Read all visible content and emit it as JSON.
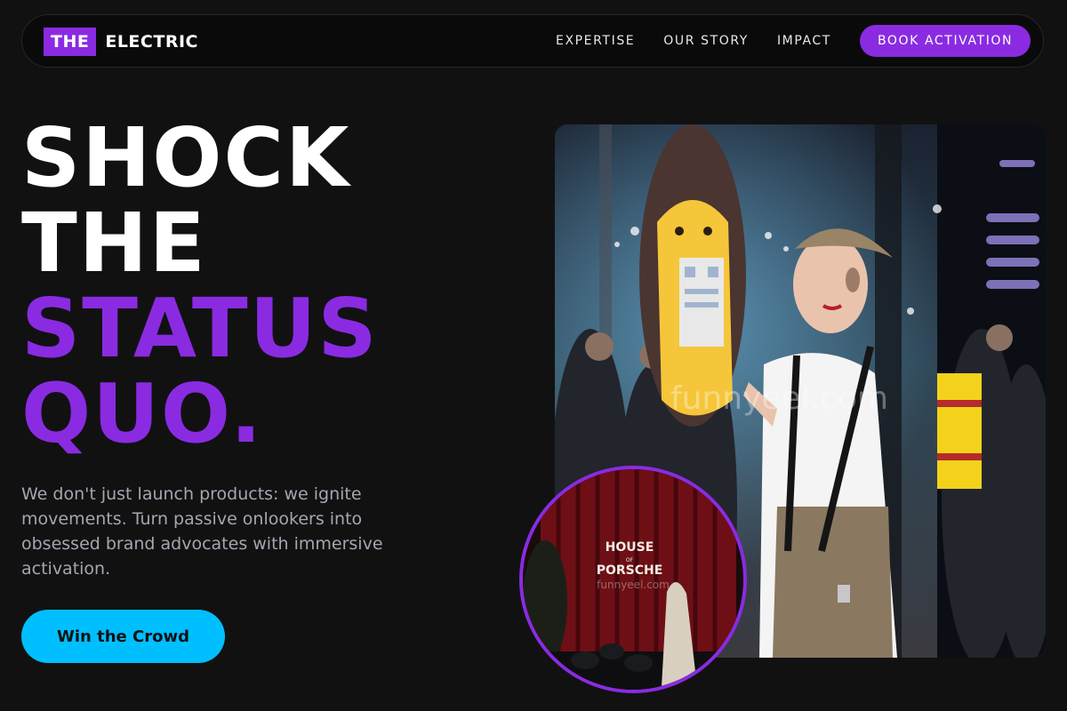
{
  "brand": {
    "box_text": "THE",
    "word": "ELECTRIC",
    "accent_color": "#8a2be2"
  },
  "nav": {
    "links": [
      "EXPERTISE",
      "OUR STORY",
      "IMPACT"
    ],
    "cta_label": "BOOK ACTIVATION"
  },
  "hero": {
    "headline_lines": [
      "SHOCK",
      "THE",
      "STATUS",
      "QUO."
    ],
    "subheading": "We don't just launch products: we ignite movements. Turn passive onlookers into obsessed brand advocates with immersive activation.",
    "cta_label": "Win the Crowd",
    "cta_color": "#00bfff"
  },
  "images": {
    "main_photo_watermark": "funnyeel.com",
    "event_sign_lines": [
      "HOUSE",
      "OF",
      "PORSCHE"
    ],
    "event_photo_watermark": "funnyeel.com"
  }
}
